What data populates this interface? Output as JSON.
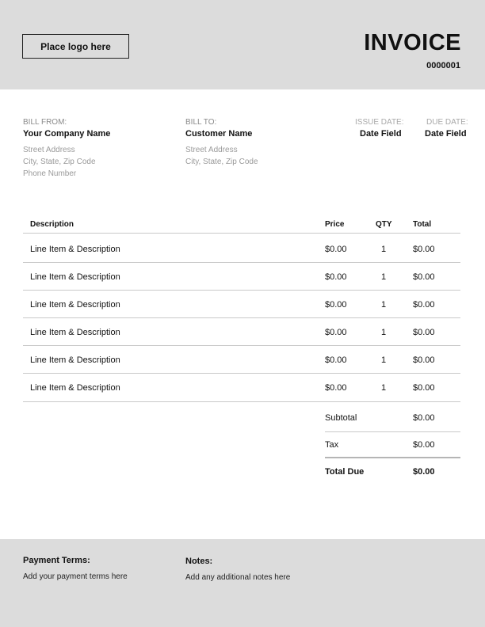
{
  "header": {
    "logo_placeholder": "Place logo here",
    "title": "INVOICE",
    "number": "0000001"
  },
  "bill_from": {
    "label": "BILL FROM:",
    "name": "Your Company Name",
    "street": "Street Address",
    "city": "City, State, Zip Code",
    "phone": "Phone Number"
  },
  "bill_to": {
    "label": "BILL TO:",
    "name": "Customer Name",
    "street": "Street Address",
    "city": "City, State, Zip Code"
  },
  "dates": {
    "issue_label": "ISSUE DATE:",
    "issue_value": "Date Field",
    "due_label": "DUE DATE:",
    "due_value": "Date Field"
  },
  "table": {
    "headers": [
      "Description",
      "Price",
      "QTY",
      "Total"
    ],
    "rows": [
      {
        "description": "Line Item & Description",
        "price": "$0.00",
        "qty": "1",
        "total": "$0.00"
      },
      {
        "description": "Line Item & Description",
        "price": "$0.00",
        "qty": "1",
        "total": "$0.00"
      },
      {
        "description": "Line Item & Description",
        "price": "$0.00",
        "qty": "1",
        "total": "$0.00"
      },
      {
        "description": "Line Item & Description",
        "price": "$0.00",
        "qty": "1",
        "total": "$0.00"
      },
      {
        "description": "Line Item & Description",
        "price": "$0.00",
        "qty": "1",
        "total": "$0.00"
      },
      {
        "description": "Line Item & Description",
        "price": "$0.00",
        "qty": "1",
        "total": "$0.00"
      }
    ]
  },
  "summary": {
    "subtotal_label": "Subtotal",
    "subtotal_value": "$0.00",
    "tax_label": "Tax",
    "tax_value": "$0.00",
    "total_label": "Total Due",
    "total_value": "$0.00"
  },
  "footer": {
    "terms_title": "Payment Terms:",
    "terms_text": "Add your payment terms here",
    "notes_title": "Notes:",
    "notes_text": "Add any additional notes here"
  },
  "colors": {
    "band": "#dcdcdc",
    "rule": "#c8c8c8",
    "muted_text": "#8a8a8a"
  }
}
